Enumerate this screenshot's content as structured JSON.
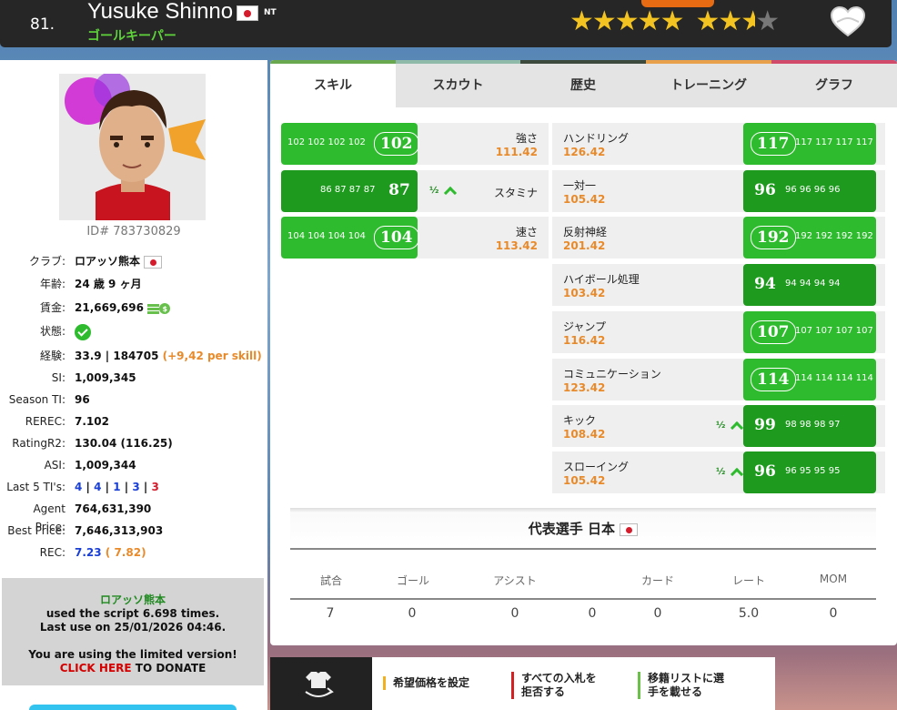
{
  "header": {
    "rank": "81.",
    "name": "Yusuke Shinno",
    "nt_badge": "NT",
    "position": "ゴールキーパー",
    "favorite_icon": "heart-icon",
    "rating_stars": "5 + 2.5 / 4"
  },
  "tabs": [
    "スキル",
    "スカウト",
    "歴史",
    "トレーニング",
    "グラフ"
  ],
  "profile": {
    "id_label": "ID# 783730829",
    "rows": [
      {
        "label": "クラブ:",
        "value": "ロアッソ熊本"
      },
      {
        "label": "年齢:",
        "value": "24 歳 9 ヶ月"
      },
      {
        "label": "賃金:",
        "value": "21,669,696"
      },
      {
        "label": "状態:",
        "value": ""
      },
      {
        "label": "経験:",
        "value": "33.9 | 184705",
        "extra": "(+9,42 per skill)"
      },
      {
        "label": "SI:",
        "value": "1,009,345"
      },
      {
        "label": "Season TI:",
        "value": "96"
      },
      {
        "label": "REREC:",
        "value": "7.102"
      },
      {
        "label": "RatingR2:",
        "value": "130.04 (116.25)"
      },
      {
        "label": "ASI:",
        "value": "1,009,344"
      },
      {
        "label": "Last 5 TI's:",
        "values": [
          "4",
          "4",
          "1",
          "3",
          "3"
        ],
        "sep": "|"
      },
      {
        "label": "Agent Price:",
        "value": "764,631,390"
      },
      {
        "label": "Best Price:",
        "value": "7,646,313,903"
      },
      {
        "label": "REC:",
        "value": "7.23",
        "extra": "( 7.82)"
      }
    ]
  },
  "script_box": {
    "club": "ロアッソ熊本",
    "line1": "used the script 6.698 times.",
    "line2": "Last use on 25/01/2026 04:46.",
    "line3": "You are using the limited version!",
    "click": "CLICK HERE",
    "donate": " TO DONATE"
  },
  "skills_left": [
    {
      "name": "強さ",
      "pot": "111.42",
      "value": "102",
      "hist": "102 102 102 102",
      "up": false
    },
    {
      "name": "スタミナ",
      "pot": "",
      "value": "87",
      "hist": "86 87 87 87",
      "up": true,
      "half": "½"
    },
    {
      "name": "速さ",
      "pot": "113.42",
      "value": "104",
      "hist": "104 104 104 104",
      "up": false
    }
  ],
  "skills_right": [
    {
      "name": "ハンドリング",
      "pot": "126.42",
      "value": "117",
      "hist": "117 117 117 117",
      "up": false
    },
    {
      "name": "一対一",
      "pot": "105.42",
      "value": "96",
      "hist": "96 96 96 96",
      "up": false
    },
    {
      "name": "反射神経",
      "pot": "201.42",
      "value": "192",
      "hist": "192 192 192 192",
      "up": false
    },
    {
      "name": "ハイボール処理",
      "pot": "103.42",
      "value": "94",
      "hist": "94 94 94 94",
      "up": false
    },
    {
      "name": "ジャンプ",
      "pot": "116.42",
      "value": "107",
      "hist": "107 107 107 107",
      "up": false
    },
    {
      "name": "コミュニケーション",
      "pot": "123.42",
      "value": "114",
      "hist": "114 114 114 114",
      "up": false
    },
    {
      "name": "キック",
      "pot": "108.42",
      "value": "99",
      "hist": "98 98 98 97",
      "up": true,
      "half": "½"
    },
    {
      "name": "スローイング",
      "pot": "105.42",
      "value": "96",
      "hist": "96 95 95 95",
      "up": true,
      "half": "½"
    }
  ],
  "national": {
    "title": "代表選手 日本",
    "headers": [
      "試合",
      "ゴール",
      "アシスト",
      "カード",
      "レート",
      "MOM"
    ],
    "values": [
      "7",
      "0",
      "0",
      "0",
      "0",
      "5.0",
      "0"
    ]
  },
  "bottom_bar": {
    "btn1": "希望価格を設定",
    "btn2a": "すべての入札を",
    "btn2b": "拒否する",
    "btn3a": "移籍リストに選",
    "btn3b": "手を載せる"
  },
  "colors": {
    "green": "#2ebc2e",
    "dark_green": "#1e9a1e",
    "orange": "#e88a2a",
    "star": "#f3c322"
  }
}
